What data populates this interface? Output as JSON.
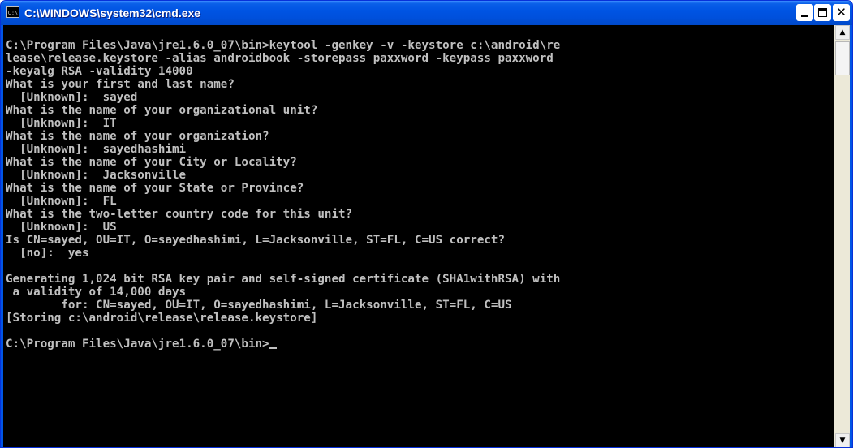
{
  "window": {
    "title": "C:\\WINDOWS\\system32\\cmd.exe",
    "icon": "cmd-icon",
    "icon_text": "C:\\",
    "controls": {
      "minimize": "minimize-icon",
      "maximize": "maximize-icon",
      "close": "close-icon",
      "close_glyph": "✕"
    }
  },
  "colors": {
    "console_background": "#000000",
    "console_text": "#c0c0c0",
    "titlebar": "#0054e3"
  },
  "console": {
    "lines": [
      "C:\\Program Files\\Java\\jre1.6.0_07\\bin>keytool -genkey -v -keystore c:\\android\\re",
      "lease\\release.keystore -alias androidbook -storepass paxxword -keypass paxxword",
      "-keyalg RSA -validity 14000",
      "What is your first and last name?",
      "  [Unknown]:  sayed",
      "What is the name of your organizational unit?",
      "  [Unknown]:  IT",
      "What is the name of your organization?",
      "  [Unknown]:  sayedhashimi",
      "What is the name of your City or Locality?",
      "  [Unknown]:  Jacksonville",
      "What is the name of your State or Province?",
      "  [Unknown]:  FL",
      "What is the two-letter country code for this unit?",
      "  [Unknown]:  US",
      "Is CN=sayed, OU=IT, O=sayedhashimi, L=Jacksonville, ST=FL, C=US correct?",
      "  [no]:  yes",
      "",
      "Generating 1,024 bit RSA key pair and self-signed certificate (SHA1withRSA) with",
      " a validity of 14,000 days",
      "        for: CN=sayed, OU=IT, O=sayedhashimi, L=Jacksonville, ST=FL, C=US",
      "[Storing c:\\android\\release\\release.keystore]",
      "",
      "C:\\Program Files\\Java\\jre1.6.0_07\\bin>"
    ]
  },
  "scrollbar": {
    "up_arrow": "▲",
    "down_arrow": "▼"
  }
}
